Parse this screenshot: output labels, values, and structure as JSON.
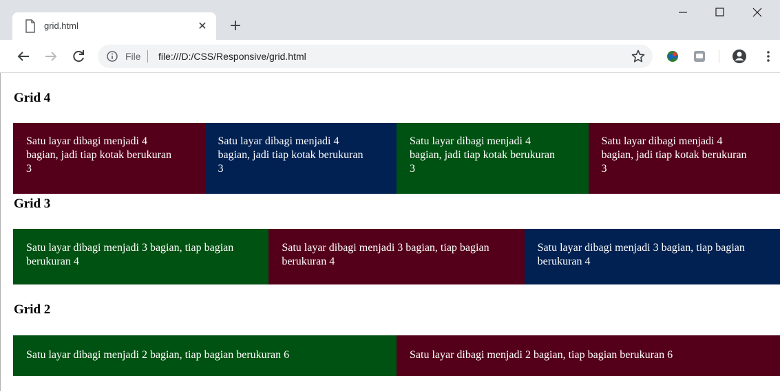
{
  "browser": {
    "tab_title": "grid.html",
    "scheme_label": "File",
    "url": "file:///D:/CSS/Responsive/grid.html"
  },
  "colors": {
    "maroon": "#55001a",
    "navy": "#002152",
    "green": "#005212"
  },
  "page": {
    "sections": [
      {
        "heading": "Grid 4",
        "cells": [
          {
            "text": "Satu layar dibagi menjadi 4 bagian, jadi tiap kotak berukuran 3",
            "color": "#55001a"
          },
          {
            "text": "Satu layar dibagi menjadi 4 bagian, jadi tiap kotak berukuran 3",
            "color": "#002152"
          },
          {
            "text": "Satu layar dibagi menjadi 4 bagian, jadi tiap kotak berukuran 3",
            "color": "#005212"
          },
          {
            "text": "Satu layar dibagi menjadi 4 bagian, jadi tiap kotak berukuran 3",
            "color": "#55001a"
          }
        ]
      },
      {
        "heading": "Grid 3",
        "cells": [
          {
            "text": "Satu layar dibagi menjadi 3 bagian, tiap bagian berukuran 4",
            "color": "#005212"
          },
          {
            "text": "Satu layar dibagi menjadi 3 bagian, tiap bagian berukuran 4",
            "color": "#55001a"
          },
          {
            "text": "Satu layar dibagi menjadi 3 bagian, tiap bagian berukuran 4",
            "color": "#002152"
          }
        ]
      },
      {
        "heading": "Grid 2",
        "cells": [
          {
            "text": "Satu layar dibagi menjadi 2 bagian, tiap bagian berukuran 6",
            "color": "#005212"
          },
          {
            "text": "Satu layar dibagi menjadi 2 bagian, tiap bagian berukuran 6",
            "color": "#55001a"
          }
        ]
      }
    ]
  }
}
